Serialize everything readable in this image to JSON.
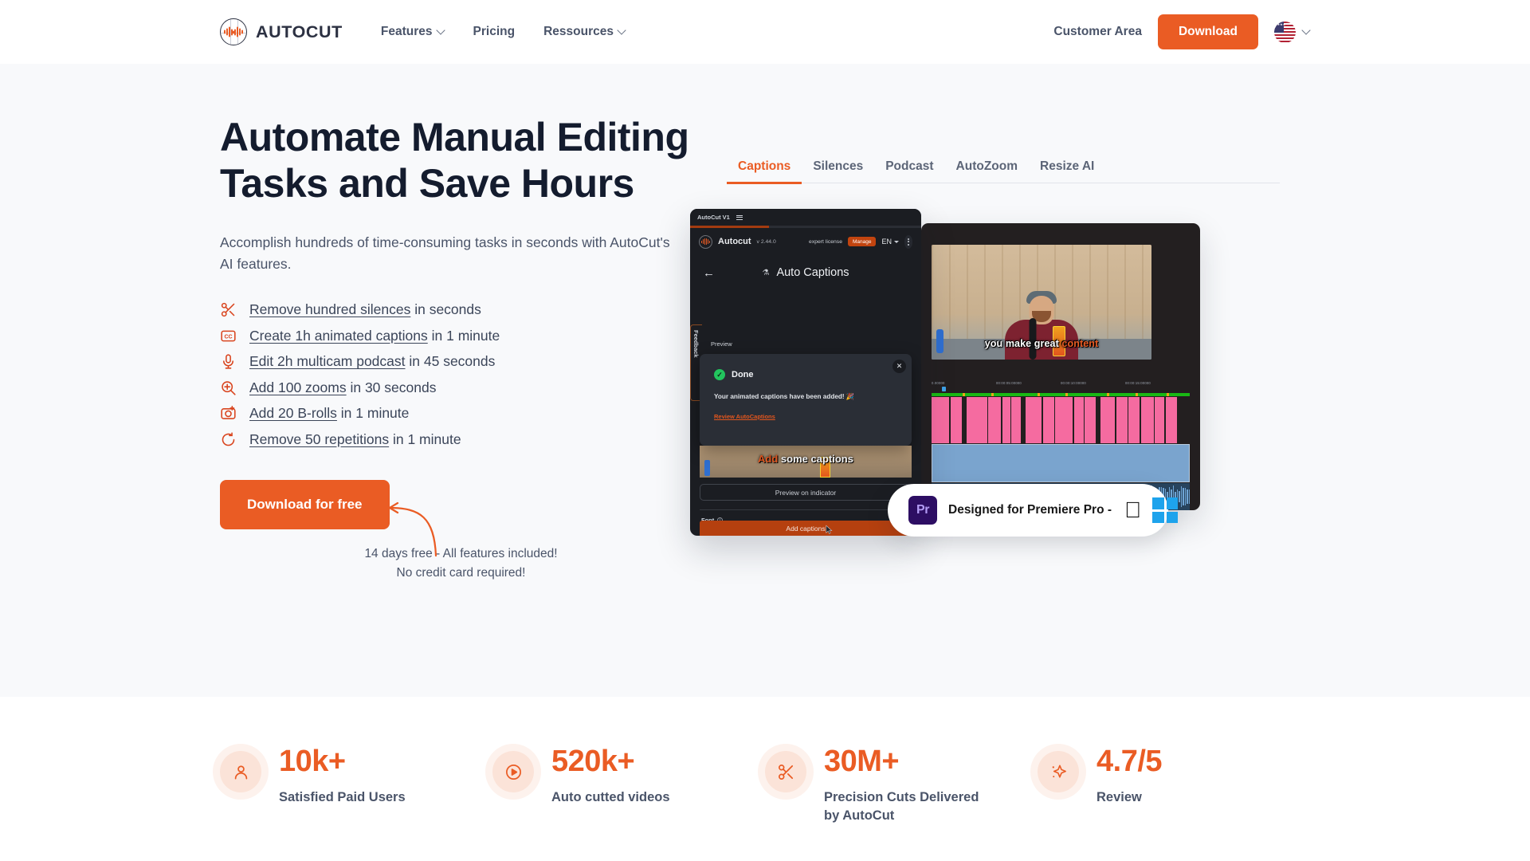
{
  "header": {
    "brand_name": "AUTOCUT",
    "nav": [
      {
        "label": "Features",
        "has_dropdown": true
      },
      {
        "label": "Pricing",
        "has_dropdown": false
      },
      {
        "label": "Ressources",
        "has_dropdown": true
      }
    ],
    "customer_area": "Customer Area",
    "download_label": "Download",
    "language": "US"
  },
  "hero": {
    "title": "Automate Manual Editing Tasks and Save Hours",
    "subtitle": "Accomplish hundreds of time-consuming tasks in seconds with AutoCut's AI features.",
    "features": [
      {
        "icon": "scissors-icon",
        "link": "Remove hundred silences",
        "rest": " in seconds"
      },
      {
        "icon": "closed-caption-icon",
        "link": "Create 1h animated captions",
        "rest": " in 1 minute"
      },
      {
        "icon": "microphone-icon",
        "link": "Edit 2h multicam podcast",
        "rest": " in 45 seconds"
      },
      {
        "icon": "zoom-in-icon",
        "link": "Add 100 zooms",
        "rest": " in 30 seconds"
      },
      {
        "icon": "camera-plus-icon",
        "link": "Add 20 B-rolls",
        "rest": " in 1 minute"
      },
      {
        "icon": "repeat-icon",
        "link": "Remove 50 repetitions",
        "rest": " in 1 minute"
      }
    ],
    "cta_label": "Download for free",
    "cta_note_line1": "14 days free - All features included!",
    "cta_note_line2": "No credit card required!",
    "accent_color": "#ea5c24",
    "background": "#f8f9fb"
  },
  "product": {
    "tabs": [
      {
        "label": "Captions",
        "active": true
      },
      {
        "label": "Silences",
        "active": false
      },
      {
        "label": "Podcast",
        "active": false
      },
      {
        "label": "AutoZoom",
        "active": false
      },
      {
        "label": "Resize AI",
        "active": false
      }
    ],
    "autocut_panel": {
      "titlebar": "AutoCut V1",
      "app_name": "Autocut",
      "version": "v 2.44.0",
      "license": "expert license",
      "manage_label": "Manage",
      "language": "EN",
      "page_title": "Auto Captions",
      "feedback_label": "Feedback",
      "preview_label": "Preview",
      "modal": {
        "status": "Done",
        "message": "Your animated captions have been added! 🎉",
        "link": "Review AutoCaptions",
        "close": "✕"
      },
      "preview_caption_highlight": "Add",
      "preview_caption_rest": " some captions",
      "preview_button": "Preview on indicator",
      "font_label": "Font",
      "add_button": "Add captions"
    },
    "premiere_panel": {
      "video_caption_plain": "you make great ",
      "video_caption_highlight": "content",
      "timecodes": [
        "0.00000",
        "00:00:05:00000",
        "00:00:10:00000",
        "00:00:15:00000"
      ]
    },
    "badge": {
      "icon_label": "Pr",
      "text": "Designed for Premiere Pro  -",
      "platforms": [
        "apple",
        "windows"
      ]
    }
  },
  "stats": [
    {
      "icon": "user-icon",
      "value": "10k+",
      "label": "Satisfied Paid Users"
    },
    {
      "icon": "play-icon",
      "value": "520k+",
      "label": "Auto cutted videos"
    },
    {
      "icon": "scissors-icon",
      "value": "30M+",
      "label": "Precision Cuts Delivered by AutoCut"
    },
    {
      "icon": "sparkle-icon",
      "value": "4.7/5",
      "label": "Review"
    }
  ]
}
